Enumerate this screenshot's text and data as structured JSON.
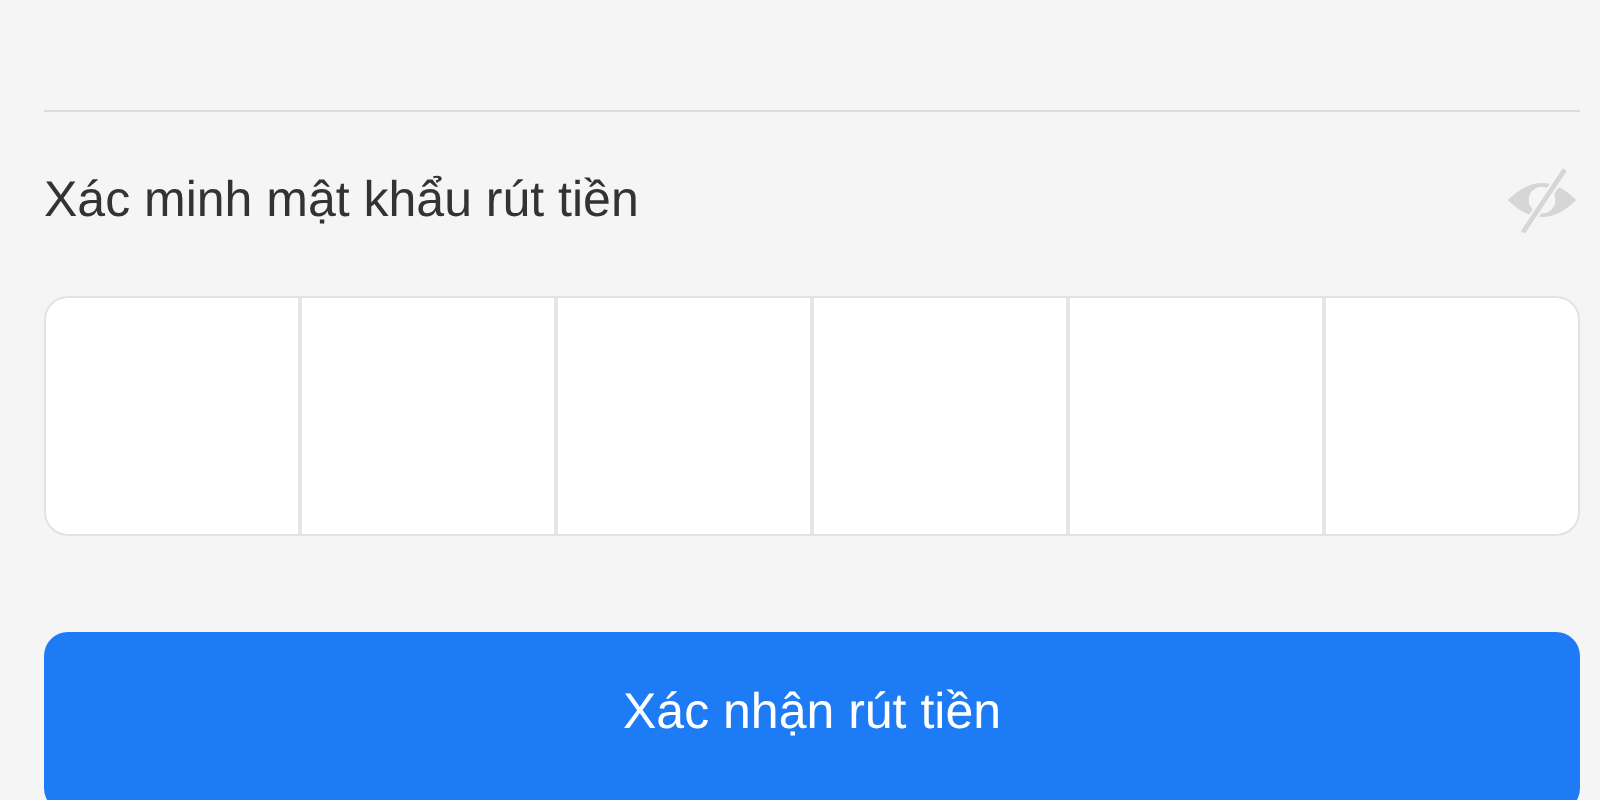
{
  "pin_label": "Xác minh mật khẩu rút tiền",
  "pin_visible": false,
  "pin_cells": [
    {
      "filled": false
    },
    {
      "filled": false
    },
    {
      "filled": false
    },
    {
      "filled": false
    },
    {
      "filled": false
    },
    {
      "filled": false
    }
  ],
  "confirm_button": "Xác nhận rút tiền"
}
